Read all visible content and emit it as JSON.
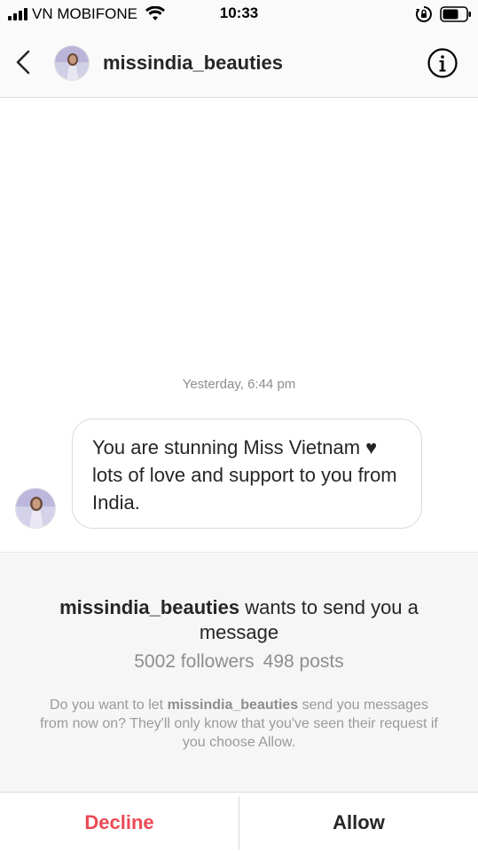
{
  "status_bar": {
    "carrier": "VN MOBIFONE",
    "time": "10:33",
    "icons": [
      "signal-icon",
      "wifi-icon",
      "rotation-lock-icon",
      "battery-icon"
    ]
  },
  "header": {
    "username": "missindia_beauties",
    "back_icon": "chevron-left-icon",
    "info_icon": "info-icon"
  },
  "conversation": {
    "timestamp": "Yesterday, 6:44 pm",
    "messages": [
      {
        "text": "You are stunning Miss Vietnam ♥ lots of love and support to you from India."
      }
    ]
  },
  "request": {
    "username": "missindia_beauties",
    "title_suffix": " wants to send you a message",
    "followers": "5002 followers",
    "posts": "498 posts",
    "desc_prefix": "Do you want to let ",
    "desc_username": "missindia_beauties",
    "desc_suffix": " send you messages from now on? They'll only know that you've seen their request if you choose Allow."
  },
  "actions": {
    "decline": "Decline",
    "allow": "Allow"
  },
  "colors": {
    "decline": "#ed4956",
    "header_bg": "#fafafa",
    "request_bg": "#f6f6f6"
  }
}
